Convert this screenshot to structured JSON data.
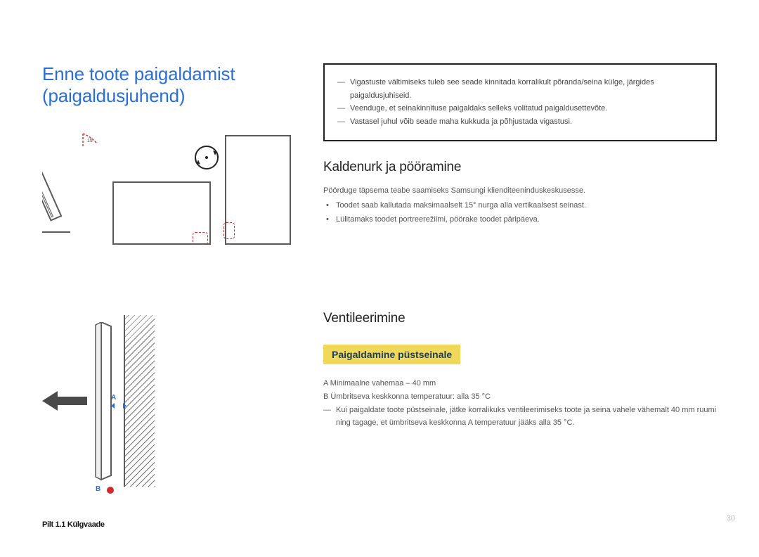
{
  "title": "Enne toote paigaldamist (paigaldusjuhend)",
  "angle_label": "15",
  "diagram2": {
    "a_label": "A",
    "b_label": "B",
    "caption": "Pilt 1.1 Külgvaade"
  },
  "infobox": {
    "lines": [
      "Vigastuste vältimiseks tuleb see seade kinnitada korralikult põranda/seina külge, järgides paigaldusjuhiseid.",
      "Veenduge, et seinakinnituse paigaldaks selleks volitatud paigaldusettevõte.",
      "Vastasel juhul võib seade maha kukkuda ja põhjustada vigastusi."
    ]
  },
  "section_tilt": {
    "heading": "Kaldenurk ja pööramine",
    "context": "Pöörduge täpsema teabe saamiseks Samsungi klienditeeninduskeskusesse.",
    "bullets": [
      "Toodet saab kallutada maksimaalselt 15° nurga alla vertikaalsest seinast.",
      "Lülitamaks toodet portreerežiimi, pöörake toodet päripäeva."
    ]
  },
  "section_vent": {
    "heading": "Ventileerimine",
    "sub_heading": "Paigaldamine püstseinale",
    "body_1": "A  Minimaalne vahemaa – 40 mm",
    "body_2": "B  Ümbritseva keskkonna temperatuur: alla 35 °C",
    "bullet": "Kui paigaldate toote püstseinale, jätke korralikuks ventileerimiseks toote ja seina vahele vähemalt 40 mm ruumi ning tagage, et ümbritseva keskkonna A temperatuur jääks alla 35 °C."
  },
  "page_number": "30"
}
